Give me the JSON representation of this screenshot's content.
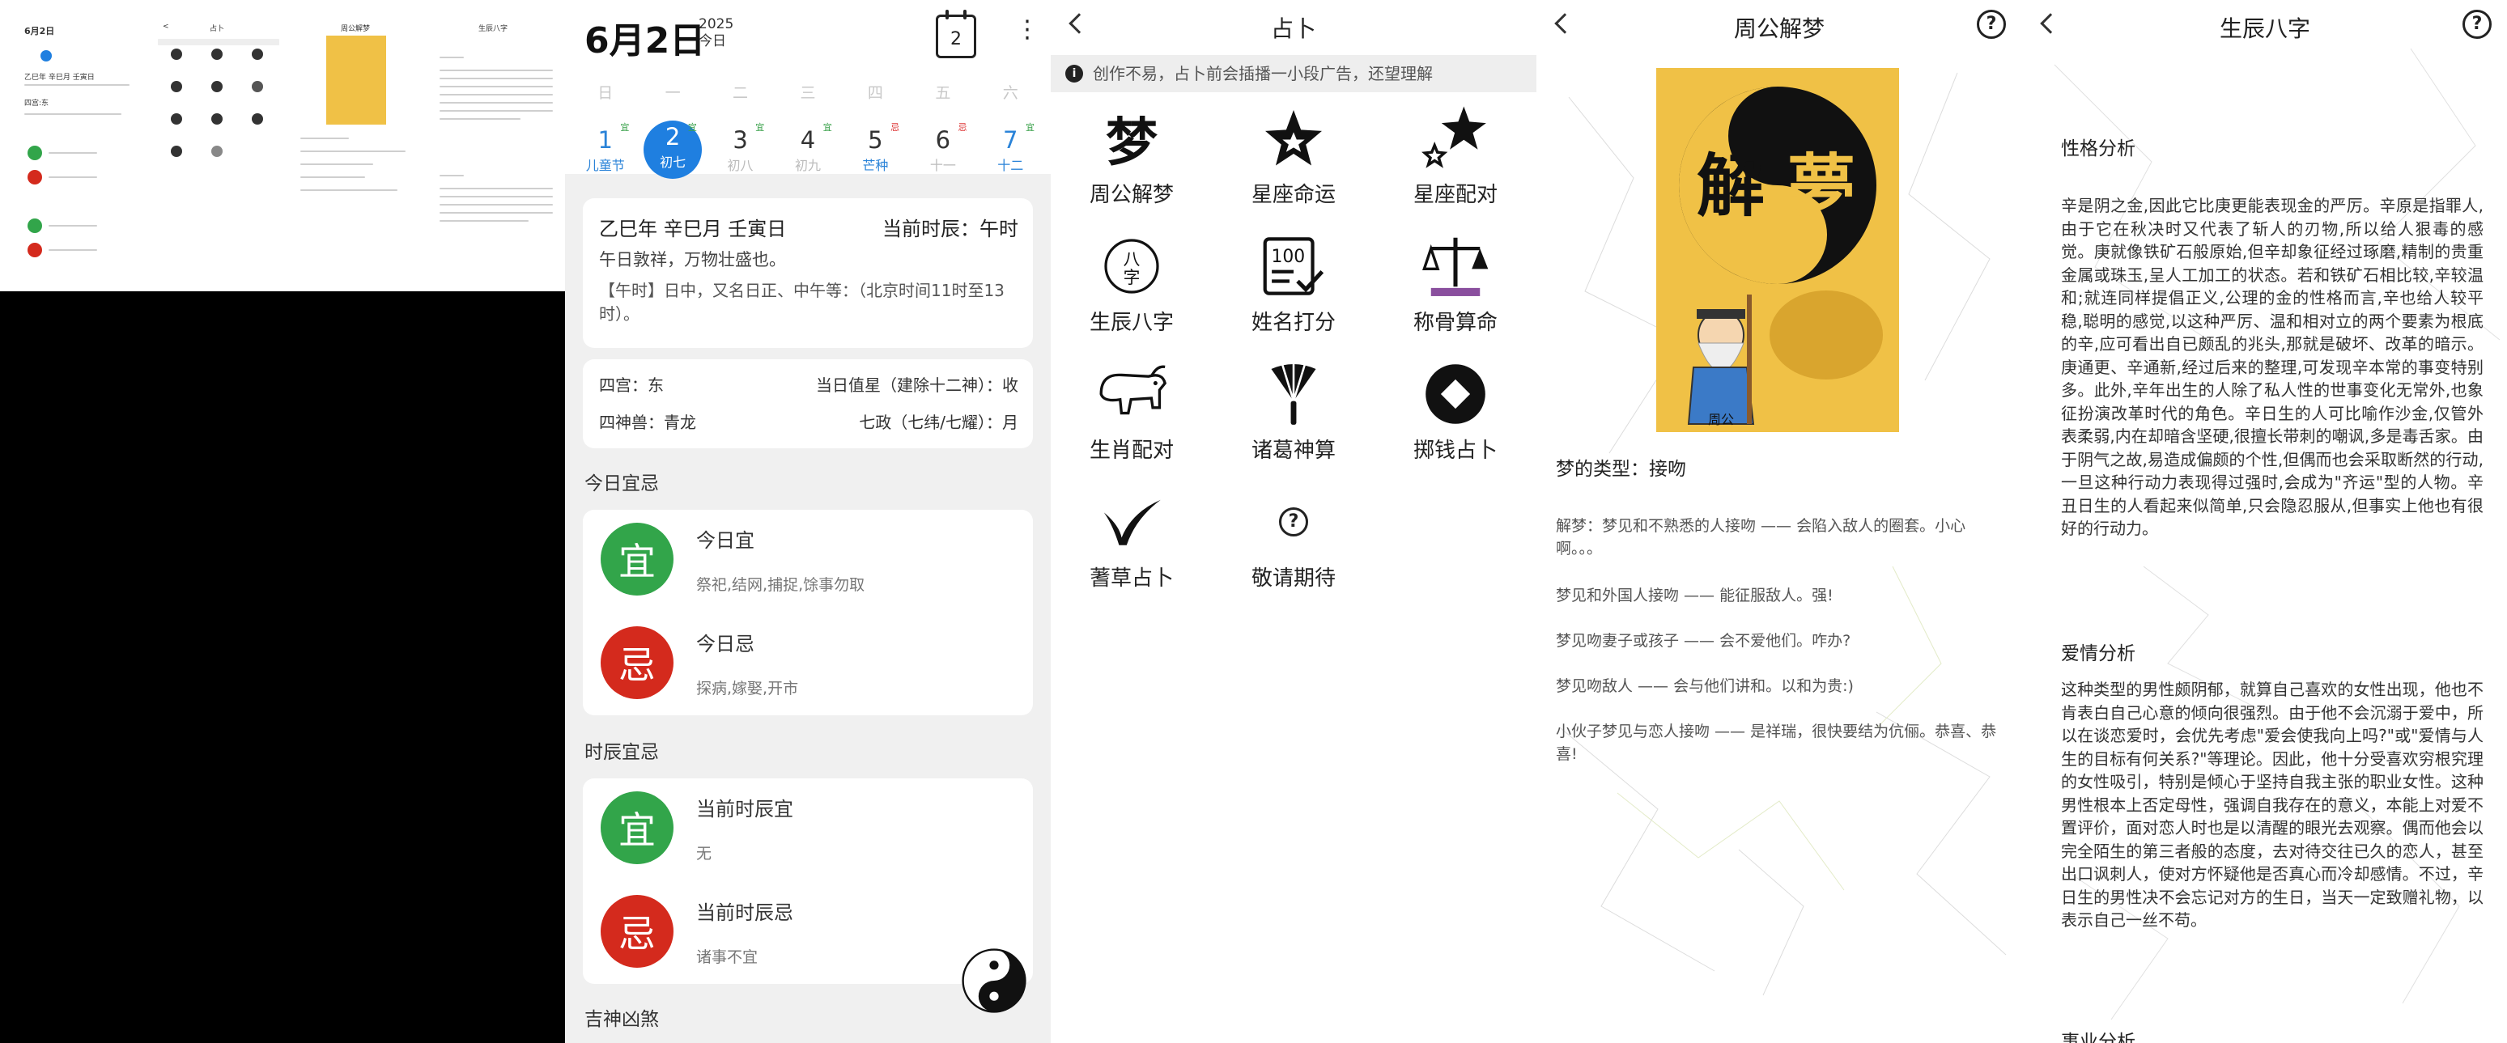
{
  "thumbnail": {
    "date": "6月2日",
    "back_glyph": "<",
    "title_divi": "占卜",
    "title_dream": "周公解梦",
    "title_bazi": "生辰八字",
    "cal_line1": "乙巳年 辛巳月 壬寅日",
    "cal_line2": "四宫:东",
    "yi_label": "宜",
    "ji_label": "忌"
  },
  "calendar": {
    "date_title": "6月2日",
    "year": "2025",
    "today": "今日",
    "calendar_icon_num": "2",
    "more_icon": "⋮",
    "weekdays": [
      "日",
      "一",
      "二",
      "三",
      "四",
      "五",
      "六"
    ],
    "days": [
      {
        "num": "1",
        "lunar": "儿童节",
        "badge": "宜"
      },
      {
        "num": "2",
        "lunar": "初七",
        "badge": "宜"
      },
      {
        "num": "3",
        "lunar": "初八",
        "badge": "宜"
      },
      {
        "num": "4",
        "lunar": "初九",
        "badge": "宜"
      },
      {
        "num": "5",
        "lunar": "芒种",
        "badge": "忌"
      },
      {
        "num": "6",
        "lunar": "十一",
        "badge": "忌"
      },
      {
        "num": "7",
        "lunar": "十二",
        "badge": "宜"
      }
    ],
    "ganzhi": "乙巳年 辛巳月 壬寅日",
    "current_shichen": "当前时辰：午时",
    "motto": "午日敦祥，万物壮盛也。",
    "wu_time": "【午时】日中，又名日正、中午等：（北京时间11时至13时）。",
    "sigong": "四宫：东",
    "zhixing": "当日值星（建除十二神）：收",
    "sishou": "四神兽：青龙",
    "qizheng": "七政（七纬/七耀）：月",
    "today_yiji_title": "今日宜忌",
    "yi_seal": "宜",
    "ji_seal": "忌",
    "today_yi_title": "今日宜",
    "today_yi_items": "祭祀,结网,捕捉,馀事勿取",
    "today_ji_title": "今日忌",
    "today_ji_items": "探病,嫁娶,开市",
    "shichen_yiji_title": "时辰宜忌",
    "sc_yi_title": "当前时辰宜",
    "sc_yi_items": "无",
    "sc_ji_title": "当前时辰忌",
    "sc_ji_items": "诸事不宜",
    "jishen_title": "吉神凶煞"
  },
  "divination": {
    "title": "占卜",
    "notice": "创作不易，占卜前会插播一小段广告，还望理解",
    "notice_icon": "i",
    "items": [
      {
        "label": "周公解梦",
        "icon": "dream-glyph-icon",
        "glyph": "梦"
      },
      {
        "label": "星座命运",
        "icon": "star-badge-icon"
      },
      {
        "label": "星座配对",
        "icon": "double-star-icon"
      },
      {
        "label": "生辰八字",
        "icon": "bazi-seal-icon",
        "glyph": "八字"
      },
      {
        "label": "姓名打分",
        "icon": "score-card-icon",
        "glyph": "100"
      },
      {
        "label": "称骨算命",
        "icon": "scale-icon"
      },
      {
        "label": "生肖配对",
        "icon": "zodiac-ox-icon"
      },
      {
        "label": "诸葛神算",
        "icon": "feather-fan-icon"
      },
      {
        "label": "掷钱占卜",
        "icon": "coin-icon"
      },
      {
        "label": "蓍草占卜",
        "icon": "yarrow-icon"
      },
      {
        "label": "敬请期待",
        "icon": "question-icon",
        "glyph": "?"
      }
    ]
  },
  "dream": {
    "title": "周公解梦",
    "help": "?",
    "poster_glyph_1": "解",
    "poster_glyph_2": "夢",
    "poster_caption": "周公",
    "type": "梦的类型：接吻",
    "paragraphs": [
      "解梦：梦见和不熟悉的人接吻 —— 会陷入敌人的圈套。小心啊。。。",
      "梦见和外国人接吻 —— 能征服敌人。强!",
      "梦见吻妻子或孩子 —— 会不爱他们。咋办?",
      "梦见吻敌人 —— 会与他们讲和。以和为贵:)",
      "小伙子梦见与恋人接吻 —— 是祥瑞，很快要结为伉俪。恭喜、恭喜!"
    ]
  },
  "bazi": {
    "title": "生辰八字",
    "help": "?",
    "personality_title": "性格分析",
    "personality_text": "辛是阴之金,因此它比庚更能表现金的严厉。辛原是指罪人,由于它在秋决时又代表了斩人的刃物,所以给人狠毒的感觉。庚就像铁矿石般原始,但辛却象征经过琢磨,精制的贵重金属或珠玉,呈人工加工的状态。若和铁矿石相比较,辛较温和;就连同样提倡正义,公理的金的性格而言,辛也给人较平稳,聪明的感觉,以这种严厉、温和相对立的两个要素为根底的辛,应可看出自已颇乱的兆头,那就是破坏、改革的暗示。庚通更、辛通新,经过后来的整理,可发现辛本常的事变特别多。此外,辛年出生的人除了私人性的世事变化无常外,也象征扮演改革时代的角色。辛日生的人可比喻作沙金,仅管外表柔弱,内在却暗含坚硬,很擅长带刺的嘲讽,多是毒舌家。由于阴气之故,易造成偏颇的个性,但偶而也会采取断然的行动,一旦这种行动力表现得过强时,会成为\"齐运\"型的人物。辛丑日生的人看起来似简单,只会隐忍服从,但事实上他也有很好的行动力。",
    "love_title": "爱情分析",
    "love_text": "这种类型的男性颇阴郁，就算自己喜欢的女性出现，他也不肯表白自己心意的倾向很强烈。由于他不会沉溺于爱中，所以在谈恋爱时，会优先考虑\"爱会使我向上吗?\"或\"爱情与人生的目标有何关系?\"等理论。因此，他十分受喜欢穷根究理的女性吸引，特别是倾心于坚持自我主张的职业女性。这种男性根本上否定母性，强调自我存在的意义，本能上对爱不置评价，面对恋人时也是以清醒的眼光去观察。偶而他会以完全陌生的第三者般的态度，去对待交往已久的恋人，甚至出口讽刺人，使对方怀疑他是否真心而冷却感情。不过，辛日生的男性决不会忘记对方的生日，当天一定致赠礼物，以表示自己一丝不苟。",
    "career_title": "事业分析"
  },
  "colors": {
    "accent_blue": "#1f7fe0",
    "yi_green": "#32a54a",
    "ji_red": "#d42a1d",
    "poster_yellow": "#f0c146",
    "scale_purple": "#8a4f9e"
  }
}
